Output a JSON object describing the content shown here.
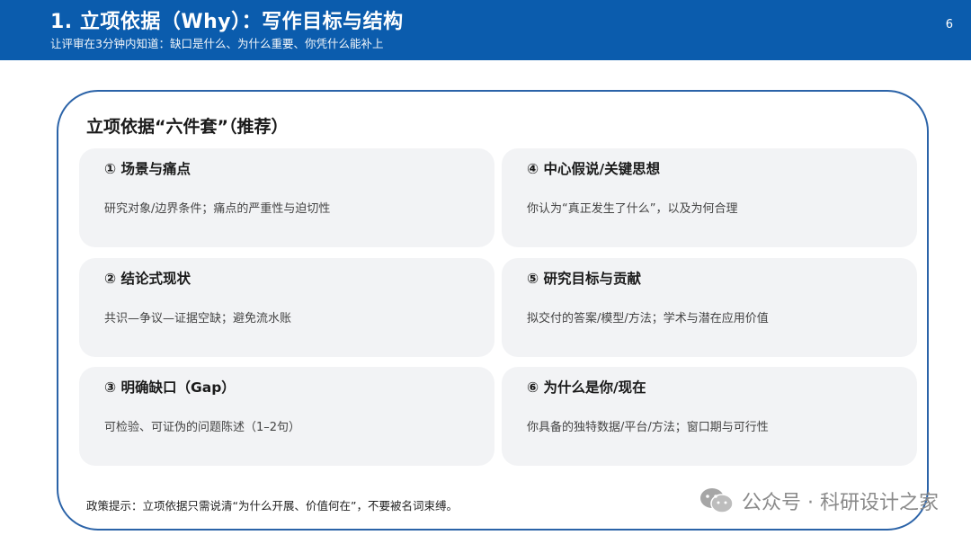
{
  "header": {
    "title": "1. 立项依据（Why）：写作目标与结构",
    "subtitle": "让评审在3分钟内知道：缺口是什么、为什么重要、你凭什么能补上",
    "page_number": "6"
  },
  "panel": {
    "title": "立项依据“六件套”（推荐）",
    "cards": [
      {
        "title": "① 场景与痛点",
        "desc": "研究对象/边界条件；痛点的严重性与迫切性"
      },
      {
        "title": "④ 中心假说/关键思想",
        "desc": "你认为“真正发生了什么”，以及为何合理"
      },
      {
        "title": "② 结论式现状",
        "desc": "共识—争议—证据空缺；避免流水账"
      },
      {
        "title": "⑤ 研究目标与贡献",
        "desc": "拟交付的答案/模型/方法；学术与潜在应用价值"
      },
      {
        "title": "③ 明确缺口（Gap）",
        "desc": "可检验、可证伪的问题陈述（1–2句）"
      },
      {
        "title": "⑥ 为什么是你/现在",
        "desc": "你具备的独特数据/平台/方法；窗口期与可行性"
      }
    ],
    "footnote": "政策提示：立项依据只需说清“为什么开展、价值何在”，不要被名词束缚。"
  },
  "watermark": {
    "text": "公众号 · 科研设计之家",
    "icon": "wechat-icon"
  },
  "colors": {
    "header_bg": "#0b5cad",
    "panel_border": "#2b63a8",
    "card_bg": "#f2f3f5"
  }
}
